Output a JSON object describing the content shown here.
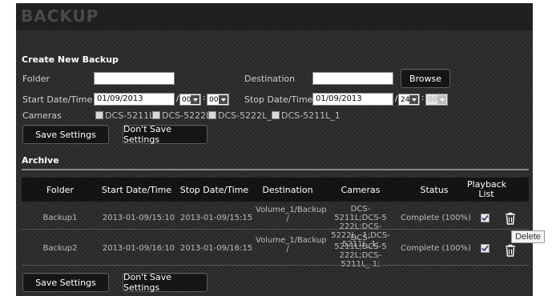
{
  "page": {
    "title": "BACKUP"
  },
  "create": {
    "title": "Create New Backup",
    "folder_label": "Folder",
    "folder_value": "",
    "destination_label": "Destination",
    "destination_value": "",
    "browse_label": "Browse",
    "start_label": "Start Date/Time",
    "start_date": "01/09/2013",
    "start_hour": "00",
    "start_minute": "00",
    "stop_label": "Stop Date/Time",
    "stop_date": "01/09/2013",
    "stop_hour": "24",
    "stop_minute": "00",
    "sep_slash": "/",
    "sep_colon": ":",
    "cameras_label": "Cameras",
    "cameras": [
      "DCS-5211L",
      "DCS-5222L",
      "DCS-5222L_1",
      "DCS-5211L_1"
    ],
    "save_label": "Save Settings",
    "dont_save_label": "Don't Save Settings"
  },
  "archive": {
    "title": "Archive",
    "columns": {
      "folder": "Folder",
      "start": "Start Date/Time",
      "stop": "Stop Date/Time",
      "destination": "Destination",
      "cameras": "Cameras",
      "status": "Status",
      "playback": "Playback List"
    },
    "rows": [
      {
        "folder": "Backup1",
        "start": "2013-01-09/15:10",
        "stop": "2013-01-09/15:15",
        "destination": "Volume_1/Backup /",
        "cameras": "DCS-5211L;DCS-5 222L;DCS-5222L_ 1;DCS-5211L_1;",
        "status": "Complete (100%)",
        "playback_checked": true
      },
      {
        "folder": "Backup2",
        "start": "2013-01-09/16:10",
        "stop": "2013-01-09/16:15",
        "destination": "Volume_1/Backup /",
        "cameras": "DCS-5211L;DCS-5 222L;DCS-5211L_ 1;",
        "status": "Complete (100%)",
        "playback_checked": true
      }
    ],
    "delete_tooltip": "Delete",
    "save_label": "Save Settings",
    "dont_save_label": "Don't Save Settings"
  },
  "icons": {
    "trash": "trash-icon",
    "checkmark": "checkmark-icon",
    "dropdown": "chevron-down-icon"
  }
}
